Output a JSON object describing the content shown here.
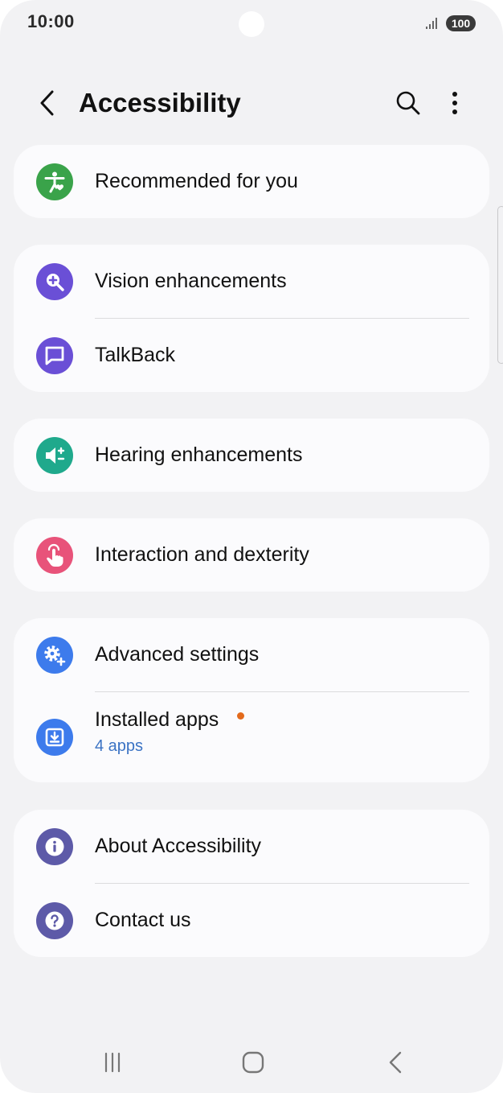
{
  "status_bar": {
    "time": "10:00",
    "battery": "100",
    "icons": [
      "signal-icon",
      "battery-icon"
    ]
  },
  "header": {
    "title": "Accessibility",
    "icons": [
      "back-arrow-icon",
      "search-icon",
      "more-options-icon"
    ]
  },
  "groups": [
    {
      "items": [
        {
          "label": "Recommended for you",
          "icon": "accessibility-person-icon",
          "icon_color": "#3aa34a"
        }
      ]
    },
    {
      "items": [
        {
          "label": "Vision enhancements",
          "icon": "zoom-in-icon",
          "icon_color": "#6a4fd6"
        },
        {
          "label": "TalkBack",
          "icon": "chat-bubble-icon",
          "icon_color": "#6a4fd6"
        }
      ]
    },
    {
      "items": [
        {
          "label": "Hearing enhancements",
          "icon": "speaker-icon",
          "icon_color": "#1fa98c"
        }
      ]
    },
    {
      "items": [
        {
          "label": "Interaction and dexterity",
          "icon": "tap-hand-icon",
          "icon_color": "#e8537a"
        }
      ]
    },
    {
      "items": [
        {
          "label": "Advanced settings",
          "icon": "gear-plus-icon",
          "icon_color": "#3d7bec"
        },
        {
          "label": "Installed apps",
          "sublabel": "4 apps",
          "icon": "download-icon",
          "icon_color": "#3d7bec",
          "notification_dot": true
        }
      ]
    },
    {
      "items": [
        {
          "label": "About Accessibility",
          "icon": "info-icon",
          "icon_color": "#5d5aa8"
        },
        {
          "label": "Contact us",
          "icon": "help-icon",
          "icon_color": "#5d5aa8"
        }
      ]
    }
  ],
  "nav_bar": {
    "icons": [
      "recent-apps-icon",
      "home-icon",
      "back-icon"
    ]
  }
}
